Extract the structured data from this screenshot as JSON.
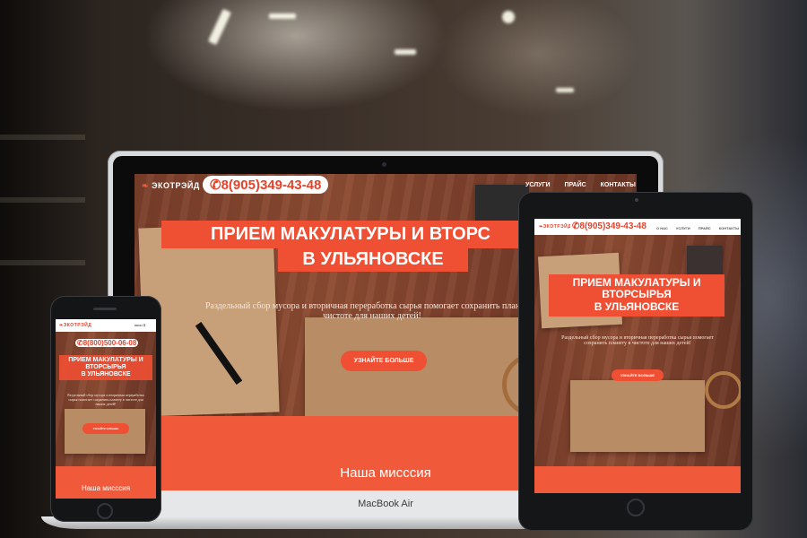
{
  "site": {
    "logo": "ЭКОТРЭЙД",
    "phone_laptop": "8(905)349-43-48",
    "phone_tablet": "8(905)349-43-48",
    "phone_mobile": "8(800)500-06-08",
    "nav_laptop": [
      "УСЛУГИ",
      "ПРАЙС",
      "КОНТАКТЫ"
    ],
    "nav_tablet": [
      "О НАС",
      "УСЛУГИ",
      "ПРАЙС",
      "КОНТАКТЫ"
    ],
    "menu_mobile": "MENU ☰",
    "hero_title_laptop": [
      "ПРИЕМ МАКУЛАТУРЫ И ВТОРС",
      "В УЛЬЯНОВСКЕ"
    ],
    "hero_title_tablet": [
      "ПРИЕМ МАКУЛАТУРЫ И",
      "ВТОРСЫРЬЯ",
      "В УЛЬЯНОВСКЕ"
    ],
    "hero_title_mobile": [
      "ПРИЕМ МАКУЛАТУРЫ И",
      "ВТОРСЫРЬЯ",
      "В УЛЬЯНОВСКЕ"
    ],
    "hero_subtitle": "Раздельный сбор мусора и вторичная переработка сырья помогает сохранить планету в чистоте для наших детей!",
    "cta": "УЗНАЙТЕ БОЛЬШЕ",
    "mission": "Наша миссcия"
  },
  "device": {
    "laptop_brand": "MacBook Air"
  },
  "colors": {
    "accent": "#f05a3a",
    "wood": "#8e4c33",
    "phone_text": "#e3432b"
  }
}
